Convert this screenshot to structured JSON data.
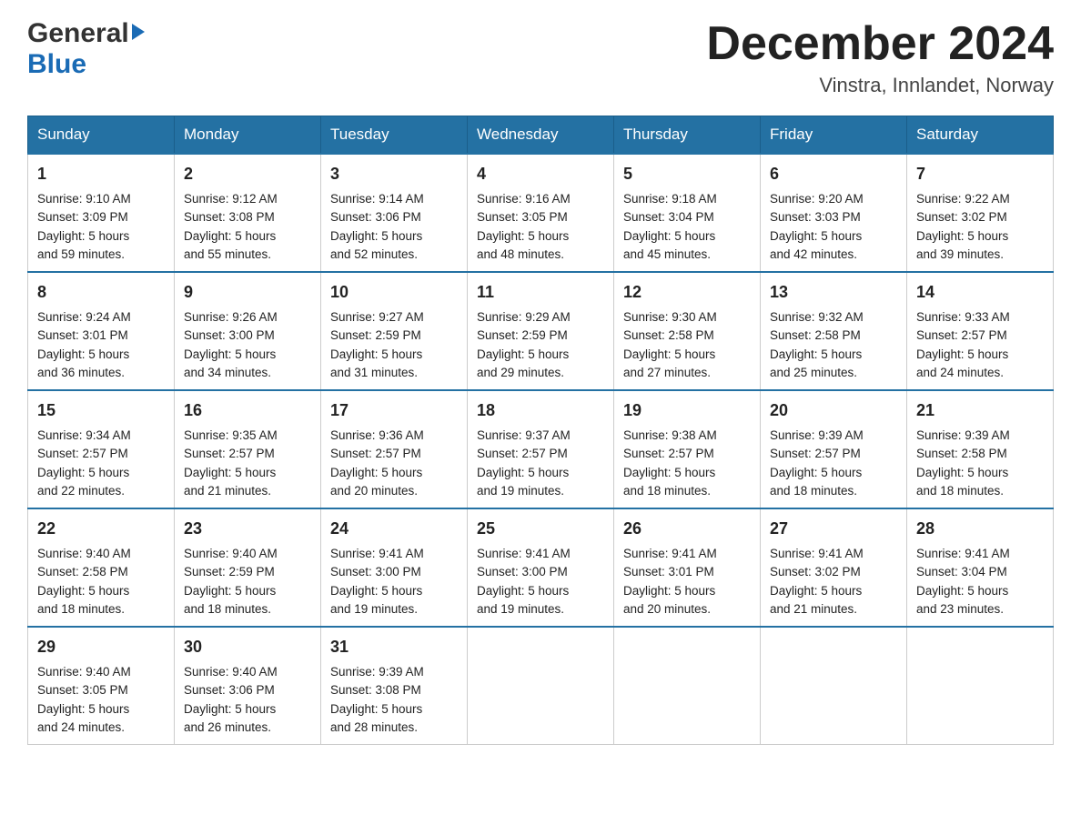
{
  "header": {
    "logo_general": "General",
    "logo_blue": "Blue",
    "month_title": "December 2024",
    "location": "Vinstra, Innlandet, Norway"
  },
  "days_of_week": [
    "Sunday",
    "Monday",
    "Tuesday",
    "Wednesday",
    "Thursday",
    "Friday",
    "Saturday"
  ],
  "weeks": [
    [
      {
        "day": "1",
        "sunrise": "9:10 AM",
        "sunset": "3:09 PM",
        "daylight": "5 hours and 59 minutes."
      },
      {
        "day": "2",
        "sunrise": "9:12 AM",
        "sunset": "3:08 PM",
        "daylight": "5 hours and 55 minutes."
      },
      {
        "day": "3",
        "sunrise": "9:14 AM",
        "sunset": "3:06 PM",
        "daylight": "5 hours and 52 minutes."
      },
      {
        "day": "4",
        "sunrise": "9:16 AM",
        "sunset": "3:05 PM",
        "daylight": "5 hours and 48 minutes."
      },
      {
        "day": "5",
        "sunrise": "9:18 AM",
        "sunset": "3:04 PM",
        "daylight": "5 hours and 45 minutes."
      },
      {
        "day": "6",
        "sunrise": "9:20 AM",
        "sunset": "3:03 PM",
        "daylight": "5 hours and 42 minutes."
      },
      {
        "day": "7",
        "sunrise": "9:22 AM",
        "sunset": "3:02 PM",
        "daylight": "5 hours and 39 minutes."
      }
    ],
    [
      {
        "day": "8",
        "sunrise": "9:24 AM",
        "sunset": "3:01 PM",
        "daylight": "5 hours and 36 minutes."
      },
      {
        "day": "9",
        "sunrise": "9:26 AM",
        "sunset": "3:00 PM",
        "daylight": "5 hours and 34 minutes."
      },
      {
        "day": "10",
        "sunrise": "9:27 AM",
        "sunset": "2:59 PM",
        "daylight": "5 hours and 31 minutes."
      },
      {
        "day": "11",
        "sunrise": "9:29 AM",
        "sunset": "2:59 PM",
        "daylight": "5 hours and 29 minutes."
      },
      {
        "day": "12",
        "sunrise": "9:30 AM",
        "sunset": "2:58 PM",
        "daylight": "5 hours and 27 minutes."
      },
      {
        "day": "13",
        "sunrise": "9:32 AM",
        "sunset": "2:58 PM",
        "daylight": "5 hours and 25 minutes."
      },
      {
        "day": "14",
        "sunrise": "9:33 AM",
        "sunset": "2:57 PM",
        "daylight": "5 hours and 24 minutes."
      }
    ],
    [
      {
        "day": "15",
        "sunrise": "9:34 AM",
        "sunset": "2:57 PM",
        "daylight": "5 hours and 22 minutes."
      },
      {
        "day": "16",
        "sunrise": "9:35 AM",
        "sunset": "2:57 PM",
        "daylight": "5 hours and 21 minutes."
      },
      {
        "day": "17",
        "sunrise": "9:36 AM",
        "sunset": "2:57 PM",
        "daylight": "5 hours and 20 minutes."
      },
      {
        "day": "18",
        "sunrise": "9:37 AM",
        "sunset": "2:57 PM",
        "daylight": "5 hours and 19 minutes."
      },
      {
        "day": "19",
        "sunrise": "9:38 AM",
        "sunset": "2:57 PM",
        "daylight": "5 hours and 18 minutes."
      },
      {
        "day": "20",
        "sunrise": "9:39 AM",
        "sunset": "2:57 PM",
        "daylight": "5 hours and 18 minutes."
      },
      {
        "day": "21",
        "sunrise": "9:39 AM",
        "sunset": "2:58 PM",
        "daylight": "5 hours and 18 minutes."
      }
    ],
    [
      {
        "day": "22",
        "sunrise": "9:40 AM",
        "sunset": "2:58 PM",
        "daylight": "5 hours and 18 minutes."
      },
      {
        "day": "23",
        "sunrise": "9:40 AM",
        "sunset": "2:59 PM",
        "daylight": "5 hours and 18 minutes."
      },
      {
        "day": "24",
        "sunrise": "9:41 AM",
        "sunset": "3:00 PM",
        "daylight": "5 hours and 19 minutes."
      },
      {
        "day": "25",
        "sunrise": "9:41 AM",
        "sunset": "3:00 PM",
        "daylight": "5 hours and 19 minutes."
      },
      {
        "day": "26",
        "sunrise": "9:41 AM",
        "sunset": "3:01 PM",
        "daylight": "5 hours and 20 minutes."
      },
      {
        "day": "27",
        "sunrise": "9:41 AM",
        "sunset": "3:02 PM",
        "daylight": "5 hours and 21 minutes."
      },
      {
        "day": "28",
        "sunrise": "9:41 AM",
        "sunset": "3:04 PM",
        "daylight": "5 hours and 23 minutes."
      }
    ],
    [
      {
        "day": "29",
        "sunrise": "9:40 AM",
        "sunset": "3:05 PM",
        "daylight": "5 hours and 24 minutes."
      },
      {
        "day": "30",
        "sunrise": "9:40 AM",
        "sunset": "3:06 PM",
        "daylight": "5 hours and 26 minutes."
      },
      {
        "day": "31",
        "sunrise": "9:39 AM",
        "sunset": "3:08 PM",
        "daylight": "5 hours and 28 minutes."
      },
      null,
      null,
      null,
      null
    ]
  ]
}
